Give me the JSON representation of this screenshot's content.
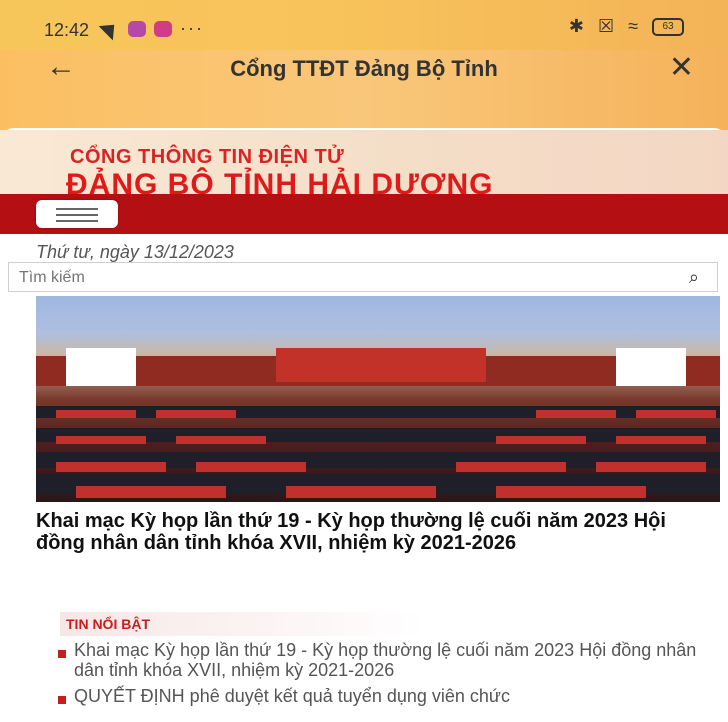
{
  "status_bar": {
    "time": "12:42",
    "icons": [
      "navigation-icon",
      "app-icon",
      "app-icon",
      "more-dots-icon",
      "bluetooth-icon",
      "sim-icon",
      "wifi-icon",
      "battery-icon"
    ],
    "battery": "63"
  },
  "header": {
    "title": "Cổng TTĐT Đảng Bộ Tỉnh",
    "back_icon": "arrow-left-icon",
    "close_icon": "close-icon"
  },
  "banner": {
    "line1": "CỔNG THÔNG TIN ĐIỆN TỬ",
    "line2": "ĐẢNG BỘ TỈNH HẢI DƯƠNG"
  },
  "menu": {
    "icon": "hamburger-menu-icon"
  },
  "date": "Thứ tư, ngày 13/12/2023",
  "search": {
    "placeholder": "Tìm kiếm",
    "icon": "search-icon"
  },
  "main_article": {
    "title": "Khai mạc Kỳ họp lần thứ 19 - Kỳ họp thường lệ cuối năm 2023 Hội đồng nhân dân tỉnh khóa XVII, nhiệm kỳ 2021-2026"
  },
  "featured": {
    "section_title": "TIN NỔI BẬT",
    "items": [
      "Khai mạc Kỳ họp lần thứ 19 - Kỳ họp thường lệ cuối năm 2023 Hội đồng nhân dân tỉnh khóa XVII, nhiệm kỳ 2021-2026",
      "QUYẾT ĐỊNH phê duyệt kết quả tuyển dụng viên chức"
    ]
  }
}
